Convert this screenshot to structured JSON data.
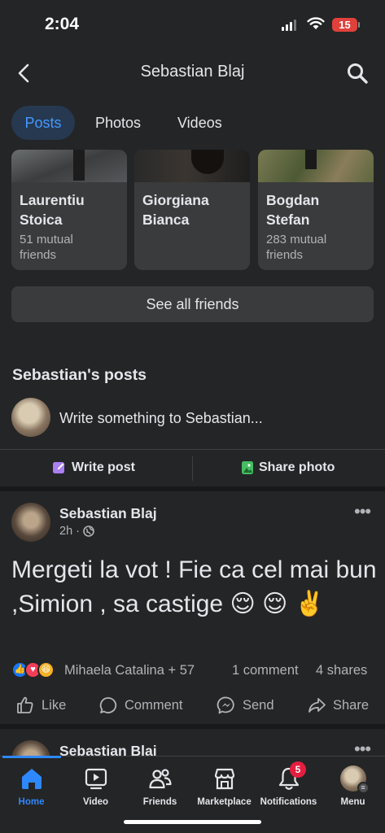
{
  "status": {
    "time": "2:04",
    "battery": "15"
  },
  "header": {
    "title": "Sebastian Blaj"
  },
  "tabs": [
    {
      "label": "Posts",
      "active": true
    },
    {
      "label": "Photos",
      "active": false
    },
    {
      "label": "Videos",
      "active": false
    }
  ],
  "friends": [
    {
      "name_line1": "Laurentiu",
      "name_line2": "Stoica",
      "mutual_line1": "51 mutual",
      "mutual_line2": "friends"
    },
    {
      "name_line1": "Giorgiana",
      "name_line2": "Bianca",
      "mutual_line1": "",
      "mutual_line2": ""
    },
    {
      "name_line1": "Bogdan",
      "name_line2": "Stefan",
      "mutual_line1": "283 mutual",
      "mutual_line2": "friends"
    }
  ],
  "see_all_friends": "See all friends",
  "posts_heading": "Sebastian's posts",
  "composer": {
    "placeholder": "Write something to Sebastian...",
    "write_post": "Write post",
    "share_photo": "Share photo"
  },
  "post": {
    "author": "Sebastian Blaj",
    "time": "2h",
    "text": "Mergeti la vot ! Fie ca cel mai bun ,Simion , sa castige 😌 😌 ✌️",
    "reaction_names": "Mihaela Catalina + 57",
    "comments": "1 comment",
    "shares": "4 shares",
    "actions": {
      "like": "Like",
      "comment": "Comment",
      "send": "Send",
      "share": "Share"
    }
  },
  "next_post": {
    "author": "Sebastian Blaj"
  },
  "nav": {
    "home": "Home",
    "video": "Video",
    "friends": "Friends",
    "marketplace": "Marketplace",
    "notifications": "Notifications",
    "menu": "Menu",
    "notifications_badge": "5"
  },
  "colors": {
    "accent": "#2d88ff",
    "background": "#242526",
    "card": "#3a3b3c",
    "badge": "#e41e3f"
  }
}
